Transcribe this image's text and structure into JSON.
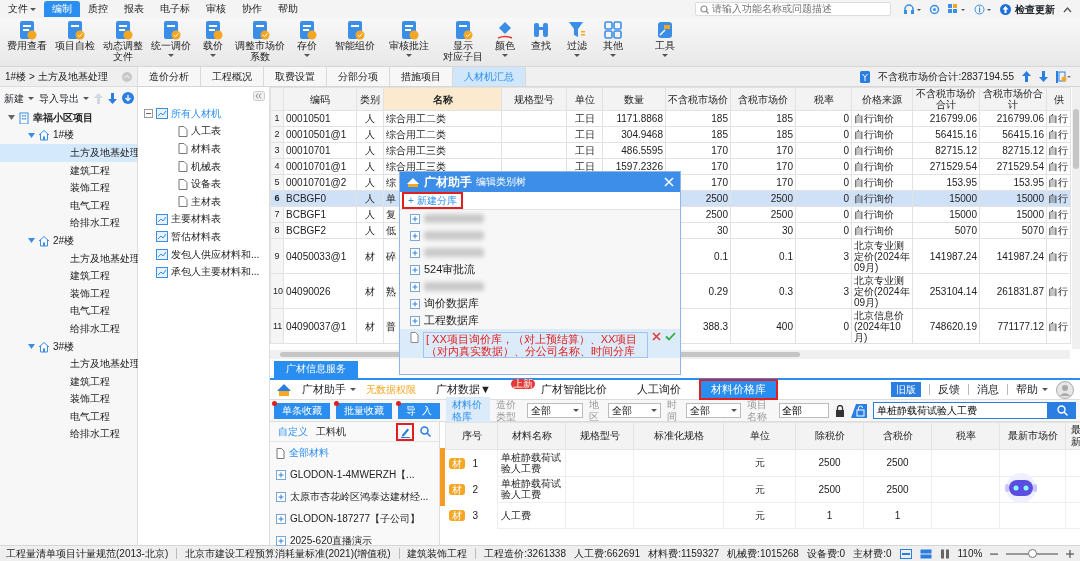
{
  "menu": [
    {
      "label": "文件",
      "selected": false,
      "dropdown": true
    },
    {
      "label": "编制",
      "selected": true,
      "dropdown": false
    },
    {
      "label": "质控",
      "selected": false,
      "dropdown": false
    },
    {
      "label": "报表",
      "selected": false,
      "dropdown": false
    },
    {
      "label": "电子标",
      "selected": false,
      "dropdown": false
    },
    {
      "label": "审核",
      "selected": false,
      "dropdown": false
    },
    {
      "label": "协作",
      "selected": false,
      "dropdown": false
    },
    {
      "label": "帮助",
      "selected": false,
      "dropdown": false
    }
  ],
  "search": {
    "placeholder": "请输入功能名称或问题描述"
  },
  "update_button": "检查更新",
  "ribbon": [
    {
      "lines": [
        "费用查看"
      ],
      "dropdown": false
    },
    {
      "lines": [
        "项目自检"
      ],
      "dropdown": false
    },
    {
      "lines": [
        "动态调整",
        "文件"
      ],
      "dropdown": false
    },
    {
      "lines": [
        "统一调价"
      ],
      "dropdown": true
    },
    {
      "lines": [
        "载价"
      ],
      "dropdown": true
    },
    {
      "lines": [
        "调整市场价",
        "系数"
      ],
      "dropdown": false
    },
    {
      "lines": [
        "存价"
      ],
      "dropdown": true
    },
    {
      "lines": [
        "智能组价"
      ],
      "dropdown": false
    },
    {
      "lines": [
        "审核批注"
      ],
      "dropdown": true
    },
    {
      "lines": [
        "显示",
        "对应子目"
      ],
      "dropdown": false
    },
    {
      "lines": [
        "颜色"
      ],
      "dropdown": true
    },
    {
      "lines": [
        "查找"
      ],
      "dropdown": false
    },
    {
      "lines": [
        "过滤"
      ],
      "dropdown": true
    },
    {
      "lines": [
        "其他"
      ],
      "dropdown": true
    },
    {
      "lines": [
        "工具"
      ],
      "dropdown": true
    }
  ],
  "breadcrumb": "1#楼 > 土方及地基处理",
  "left_toolbar": [
    {
      "label": "新建"
    },
    {
      "label": "导入导出"
    }
  ],
  "project_tree": [
    {
      "label": "幸福小区项目",
      "kind": "project",
      "expanded": true,
      "selected": false,
      "children": [
        {
          "label": "1#楼",
          "kind": "building",
          "expanded": true,
          "selected": false,
          "children": [
            {
              "label": "土方及地基处理",
              "selected": true
            },
            {
              "label": "建筑工程",
              "selected": false
            },
            {
              "label": "装饰工程",
              "selected": false
            },
            {
              "label": "电气工程",
              "selected": false
            },
            {
              "label": "给排水工程",
              "selected": false
            }
          ]
        },
        {
          "label": "2#楼",
          "kind": "building",
          "expanded": true,
          "selected": false,
          "children": [
            {
              "label": "土方及地基处理",
              "selected": false
            },
            {
              "label": "建筑工程",
              "selected": false
            },
            {
              "label": "装饰工程",
              "selected": false
            },
            {
              "label": "电气工程",
              "selected": false
            },
            {
              "label": "给排水工程",
              "selected": false
            }
          ]
        },
        {
          "label": "3#楼",
          "kind": "building",
          "expanded": true,
          "selected": false,
          "children": [
            {
              "label": "土方及地基处理",
              "selected": false
            },
            {
              "label": "建筑工程",
              "selected": false
            },
            {
              "label": "装饰工程",
              "selected": false
            },
            {
              "label": "电气工程",
              "selected": false
            },
            {
              "label": "给排水工程",
              "selected": false
            }
          ]
        }
      ]
    }
  ],
  "tabs": [
    {
      "label": "造价分析",
      "selected": false
    },
    {
      "label": "工程概况",
      "selected": false
    },
    {
      "label": "取费设置",
      "selected": false
    },
    {
      "label": "分部分项",
      "selected": false
    },
    {
      "label": "措施项目",
      "selected": false
    },
    {
      "label": "人材机汇总",
      "selected": true
    }
  ],
  "total": "不含税市场价合计:2837194.55",
  "category_tree": [
    {
      "label": "所有人材机",
      "kind": "group",
      "expanded": true,
      "selected": true,
      "children": [
        {
          "label": "人工表",
          "kind": "sheet",
          "selected": false
        },
        {
          "label": "材料表",
          "kind": "sheet",
          "selected": false
        },
        {
          "label": "机械表",
          "kind": "sheet",
          "selected": false
        },
        {
          "label": "设备表",
          "kind": "sheet",
          "selected": false
        },
        {
          "label": "主材表",
          "kind": "sheet",
          "selected": false
        }
      ]
    },
    {
      "label": "主要材料表",
      "kind": "group",
      "selected": false
    },
    {
      "label": "暂估材料表",
      "kind": "group",
      "selected": false
    },
    {
      "label": "发包人供应材料和...",
      "kind": "group",
      "selected": false
    },
    {
      "label": "承包人主要材料和...",
      "kind": "group",
      "selected": false
    }
  ],
  "table": {
    "columns": [
      "编码",
      "类别",
      "名称",
      "规格型号",
      "单位",
      "数量",
      "不含税市场价",
      "含税市场价",
      "税率",
      "价格来源",
      "不含税市场价合计",
      "含税市场价合计",
      "供"
    ],
    "rows": [
      {
        "number": "1",
        "selected": false,
        "cells": [
          "00010501",
          "人",
          "综合用工二类",
          null,
          "工日",
          "1171.8868",
          "185",
          "185",
          "0",
          "自行询价",
          "216799.06",
          "216799.06",
          "自行"
        ]
      },
      {
        "number": "2",
        "selected": false,
        "cells": [
          "00010501@1",
          "人",
          "综合用工二类",
          null,
          "工日",
          "304.9468",
          "185",
          "185",
          "0",
          "自行询价",
          "56415.16",
          "56415.16",
          "自行"
        ]
      },
      {
        "number": "3",
        "selected": false,
        "cells": [
          "00010701",
          "人",
          "综合用工三类",
          null,
          "工日",
          "486.5595",
          "170",
          "170",
          "0",
          "自行询价",
          "82715.12",
          "82715.12",
          "自行"
        ]
      },
      {
        "number": "4",
        "selected": false,
        "cells": [
          "00010701@1",
          "人",
          "综合用工三类",
          null,
          "工日",
          "1597.2326",
          "170",
          "170",
          "0",
          "自行询价",
          "271529.54",
          "271529.54",
          "自行"
        ]
      },
      {
        "number": "5",
        "selected": false,
        "cells": [
          "00010701@2",
          "人",
          "综",
          null,
          null,
          null,
          "170",
          "170",
          "0",
          "自行询价",
          "153.95",
          "153.95",
          "自行"
        ]
      },
      {
        "number": "6",
        "selected": true,
        "cells": [
          "BCBGF0",
          "人",
          "单",
          null,
          null,
          null,
          "2500",
          "2500",
          "0",
          "自行询价",
          "15000",
          "15000",
          "自行"
        ]
      },
      {
        "number": "7",
        "selected": false,
        "cells": [
          "BCBGF1",
          "人",
          "复",
          null,
          null,
          null,
          "2500",
          "2500",
          "0",
          "自行询价",
          "15000",
          "15000",
          "自行"
        ]
      },
      {
        "number": "8",
        "selected": false,
        "cells": [
          "BCBGF2",
          "人",
          "低",
          null,
          null,
          null,
          "30",
          "30",
          "0",
          "自行询价",
          "5070",
          "5070",
          "自行"
        ]
      },
      {
        "number": "9",
        "selected": false,
        "cells": [
          "04050033@1",
          "材",
          "碎",
          null,
          null,
          null,
          "0.1",
          "0.1",
          "3",
          "北京专业测定价(2024年09月)",
          "141987.24",
          "141987.24",
          "自行"
        ]
      },
      {
        "number": "10",
        "selected": false,
        "cells": [
          "04090026",
          "材",
          "熟",
          null,
          null,
          null,
          "0.29",
          "0.3",
          "3",
          "北京专业测定价(2024年09月)",
          "253104.14",
          "261831.87",
          "自行"
        ]
      },
      {
        "number": "11",
        "selected": false,
        "cells": [
          "04090037@1",
          "材",
          "普",
          null,
          null,
          null,
          "388.3",
          "400",
          "0",
          "北京信息价(2024年10月)",
          "748620.19",
          "771177.12",
          "自行"
        ]
      }
    ]
  },
  "dialog": {
    "brand": "广材助手",
    "title": "编辑类别树",
    "new_library": {
      "label": "+ 新建分库",
      "highlighted": true
    },
    "items": [
      {
        "kind": "blurred"
      },
      {
        "kind": "blurred"
      },
      {
        "kind": "blurred"
      },
      {
        "kind": "folder",
        "label": "524审批流"
      },
      {
        "kind": "blurred"
      },
      {
        "kind": "folder",
        "label": "询价数据库"
      },
      {
        "kind": "folder",
        "label": "工程数据库"
      },
      {
        "kind": "editing",
        "value": "[ XX项目询价库，（对上预结算）、XX项目（对内真实数据）、分公司名称、时间分库"
      }
    ]
  },
  "service_tab": "广材信息服务",
  "nav": {
    "brand": "广材助手",
    "permission": "无数据权限",
    "items": [
      {
        "label": "广材数据▼",
        "selected": false,
        "highlighted": false
      },
      {
        "label": "广材智能比价",
        "badge": "上新",
        "selected": false,
        "highlighted": false
      },
      {
        "label": "人工询价",
        "selected": false,
        "highlighted": false
      },
      {
        "label": "材料价格库",
        "selected": true,
        "highlighted": true
      }
    ],
    "old_version": "旧版",
    "links": [
      "反馈",
      "消息",
      "帮助"
    ]
  },
  "filters": {
    "buttons": [
      "单条收藏",
      "批量收藏",
      "导  入"
    ],
    "library": "材料价格库",
    "selects": [
      {
        "label": "造价类型",
        "value": "全部"
      },
      {
        "label": "地区",
        "value": "全部"
      },
      {
        "label": "时间",
        "value": "全部"
      }
    ],
    "project": {
      "label": "项目名称",
      "value": "全部"
    },
    "search_value": "单桩静载荷试验人工费"
  },
  "library_list": {
    "tabs": [
      {
        "label": "自定义",
        "selected": true
      },
      {
        "label": "工料机",
        "selected": false
      }
    ],
    "edit_highlighted": true,
    "items": [
      {
        "label": "全部材料",
        "kind": "all"
      },
      {
        "label": "GLODON-1-4MWERZH【...",
        "kind": "folder"
      },
      {
        "label": "太原市杏花岭区鸿泰达建材经...",
        "kind": "folder"
      },
      {
        "label": "GLODON-187277【子公司】",
        "kind": "folder"
      },
      {
        "label": "2025-620直播演示",
        "kind": "folder"
      }
    ]
  },
  "results": {
    "columns": [
      "序号",
      "材料名称",
      "规格型号",
      "标准化规格",
      "单位",
      "除税价",
      "含税价",
      "税率",
      "最新市场价",
      "最新"
    ],
    "rows": [
      {
        "tag": "材",
        "cells": [
          "1",
          "单桩静载荷试验人工费",
          null,
          null,
          "元",
          "2500",
          "2500",
          null,
          null,
          null
        ]
      },
      {
        "tag": "材",
        "cells": [
          "2",
          "单桩静载荷试验人工费",
          null,
          null,
          "元",
          "2500",
          "2500",
          null,
          null,
          null
        ]
      },
      {
        "tag": "材",
        "cells": [
          "3",
          "人工费",
          null,
          null,
          "元",
          "1",
          "1",
          null,
          null,
          null
        ]
      }
    ]
  },
  "status_bar": {
    "items": [
      "工程量清单项目计量规范(2013-北京)",
      "北京市建设工程预算消耗量标准(2021)(增值税)",
      "建筑装饰工程"
    ],
    "totals": [
      "工程造价:3261338",
      "人工费:662691",
      "材料费:1159327",
      "机械费:1015268",
      "设备费:0",
      "主材费:0"
    ],
    "zoom": "110%",
    "zoom_slider": {
      "level": 0.5
    }
  }
}
